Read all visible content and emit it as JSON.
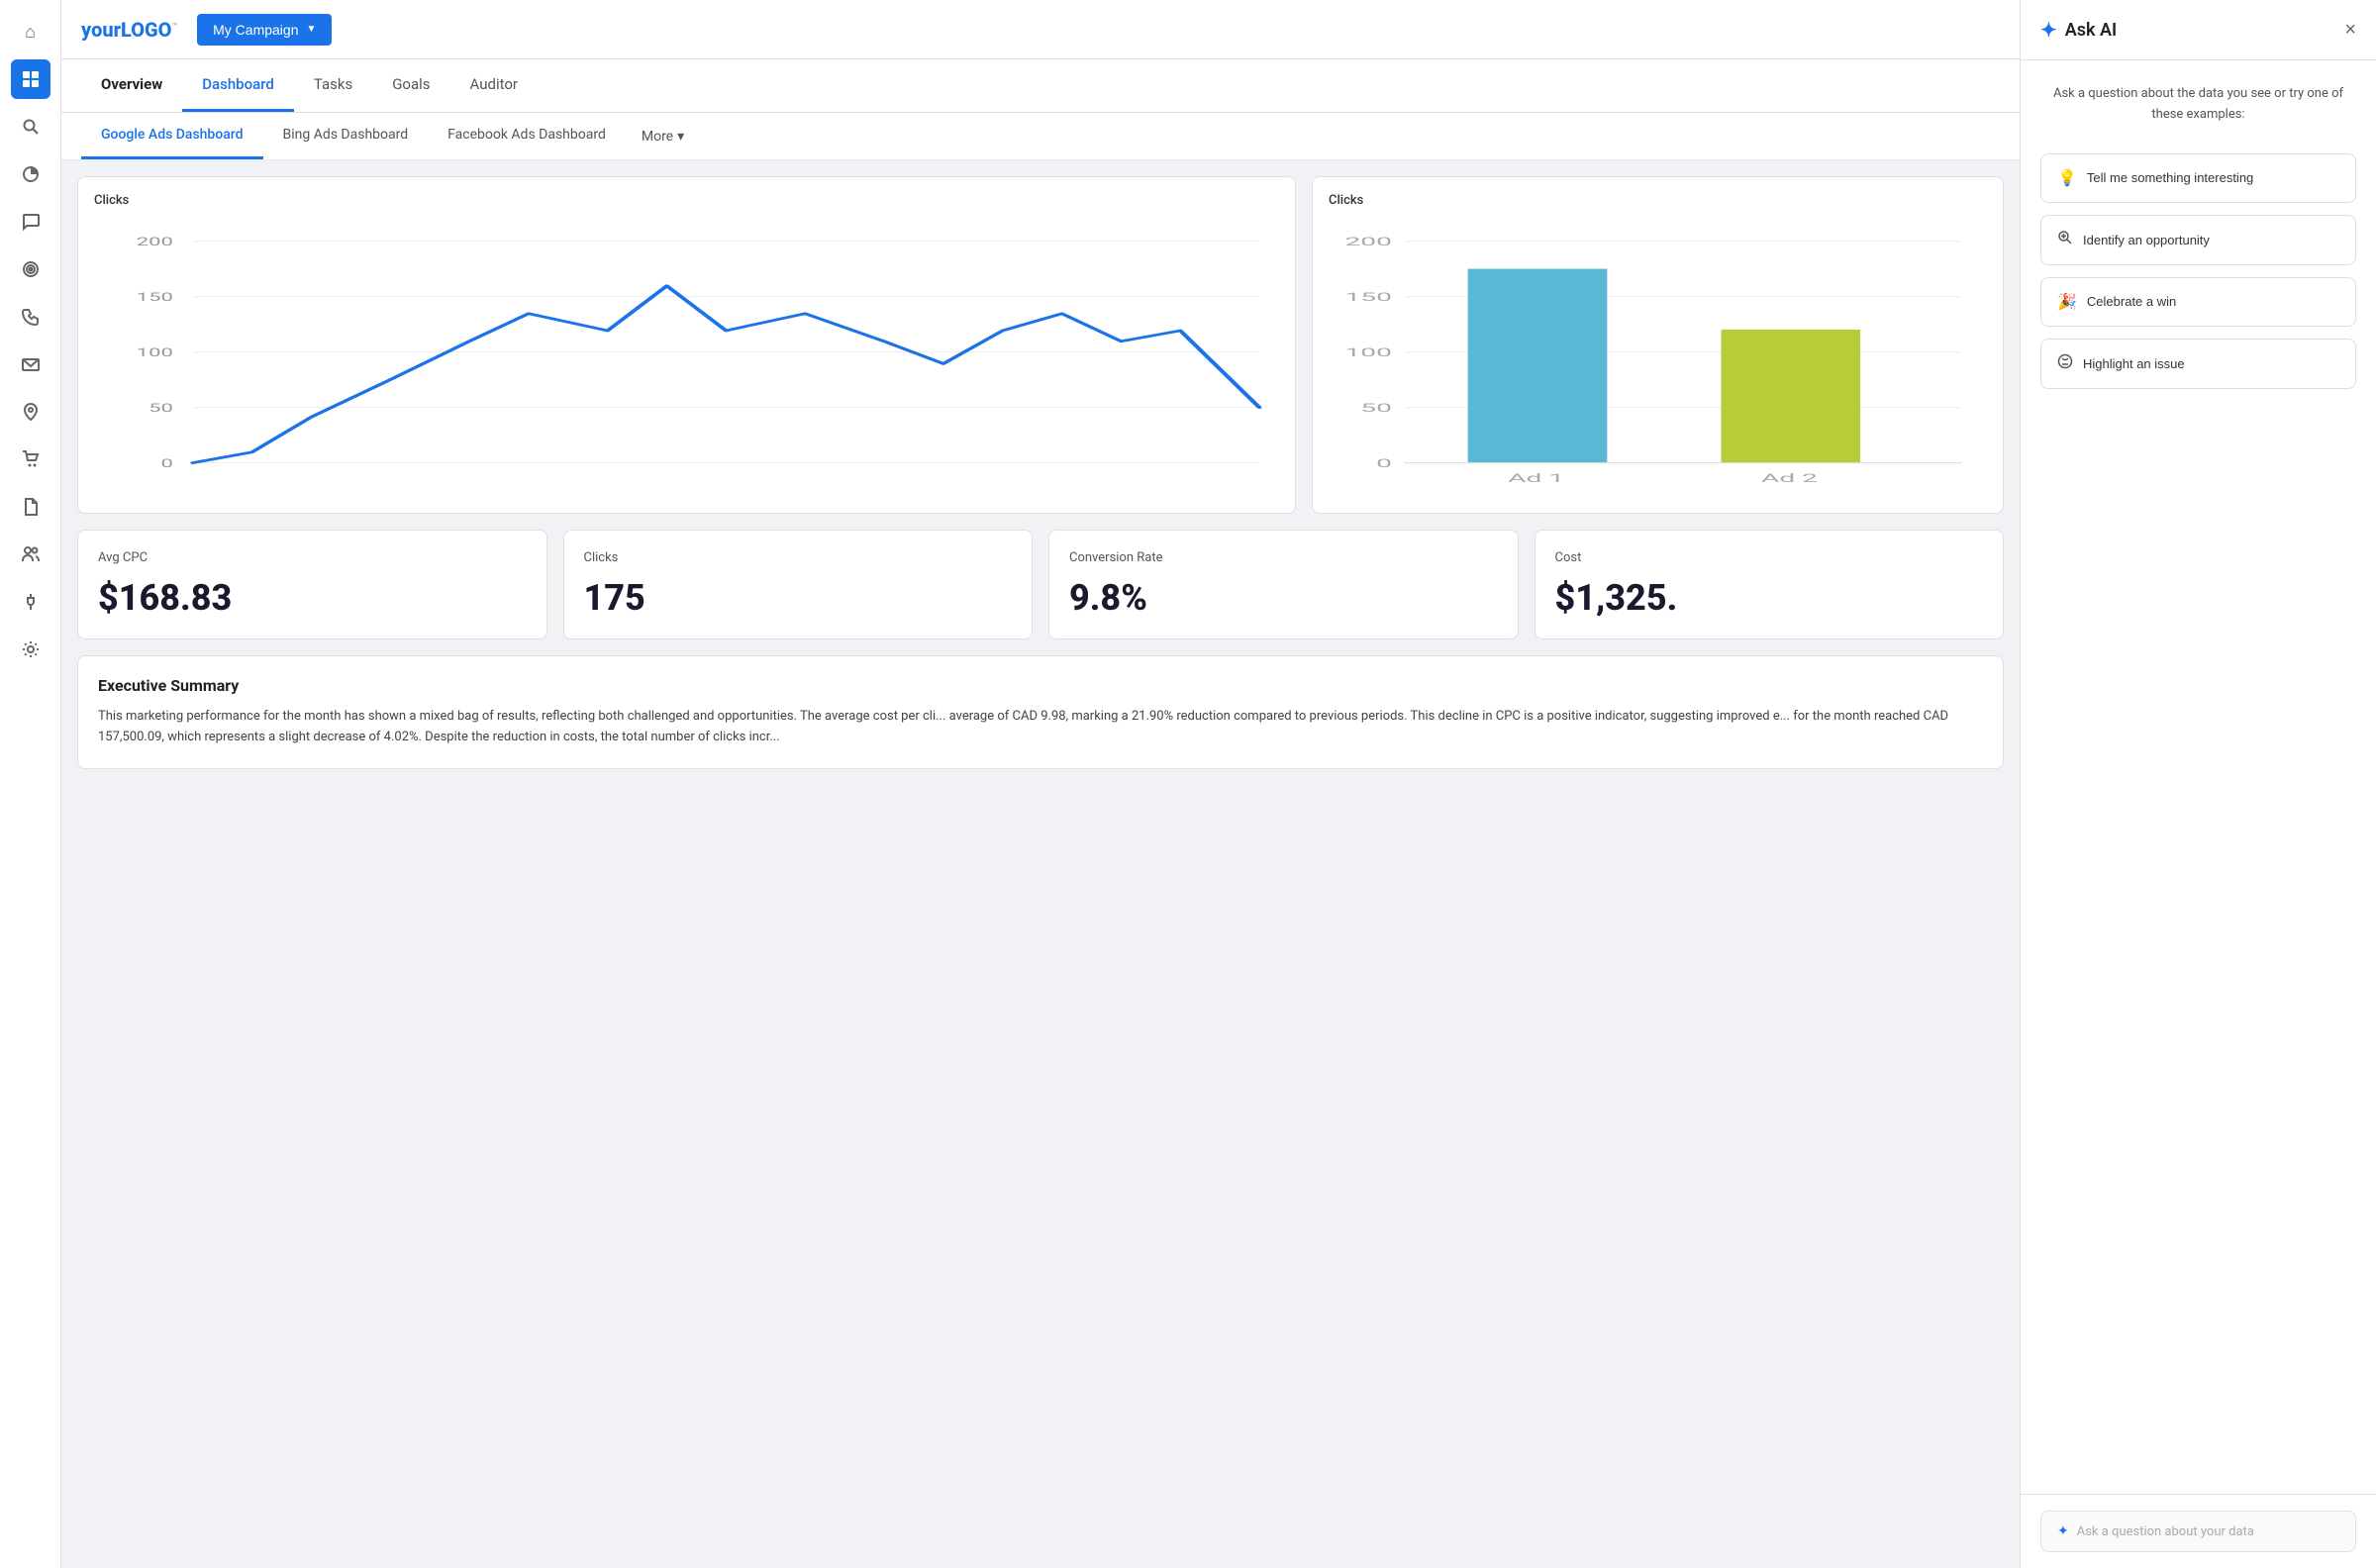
{
  "logo": {
    "text_normal": "your",
    "text_bold": "LOGO",
    "trademark": "™"
  },
  "campaign_button": {
    "label": "My Campaign",
    "chevron": "▼"
  },
  "nav": {
    "tabs": [
      {
        "id": "overview",
        "label": "Overview",
        "active": false
      },
      {
        "id": "dashboard",
        "label": "Dashboard",
        "active": true
      },
      {
        "id": "tasks",
        "label": "Tasks",
        "active": false
      },
      {
        "id": "goals",
        "label": "Goals",
        "active": false
      },
      {
        "id": "auditor",
        "label": "Auditor",
        "active": false
      }
    ]
  },
  "sub_tabs": {
    "tabs": [
      {
        "id": "google",
        "label": "Google Ads Dashboard",
        "active": true
      },
      {
        "id": "bing",
        "label": "Bing Ads Dashboard",
        "active": false
      },
      {
        "id": "facebook",
        "label": "Facebook Ads Dashboard",
        "active": false
      }
    ],
    "more_label": "More"
  },
  "charts": {
    "line_chart": {
      "title": "Clicks",
      "y_labels": [
        "200",
        "150",
        "100",
        "50",
        "0"
      ],
      "color": "#1a73e8"
    },
    "bar_chart": {
      "title": "Clicks",
      "y_labels": [
        "200",
        "150",
        "100",
        "50",
        "0"
      ],
      "bars": [
        {
          "label": "Ad 1",
          "value": 175,
          "color": "#5bb8d4"
        },
        {
          "label": "Ad 2",
          "value": 120,
          "color": "#b8cc3a"
        }
      ]
    }
  },
  "metrics": [
    {
      "label": "Avg CPC",
      "value": "$168.83"
    },
    {
      "label": "Clicks",
      "value": "175"
    },
    {
      "label": "Conversion Rate",
      "value": "9.8%"
    },
    {
      "label": "Cost",
      "value": "$1,325."
    }
  ],
  "executive_summary": {
    "title": "Executive Summary",
    "text": "This marketing performance for the month has shown a mixed bag of results, reflecting both challenged and opportunities. The average cost per cli... average of CAD 9.98, marking a 21.90% reduction compared to previous periods. This decline in CPC is a positive indicator, suggesting improved e... for the month reached CAD 157,500.09, which represents a slight decrease of 4.02%. Despite the reduction in costs, the total number of clicks incr..."
  },
  "ai_panel": {
    "title": "Ask AI",
    "close_label": "×",
    "prompt_text": "Ask a question about the data you see or try one of these examples:",
    "suggestions": [
      {
        "id": "interesting",
        "icon": "💡",
        "label": "Tell me something interesting"
      },
      {
        "id": "opportunity",
        "icon": "🔍",
        "label": "Identify an opportunity"
      },
      {
        "id": "celebrate",
        "icon": "🎉",
        "label": "Celebrate a win"
      },
      {
        "id": "issue",
        "icon": "🔊",
        "label": "Highlight an issue"
      }
    ],
    "input_placeholder": "Ask a question about your data"
  },
  "sidebar_icons": [
    {
      "id": "home",
      "icon": "⌂",
      "active": false
    },
    {
      "id": "grid",
      "icon": "⊞",
      "active": true
    },
    {
      "id": "search",
      "icon": "🔍",
      "active": false
    },
    {
      "id": "chart-pie",
      "icon": "◕",
      "active": false
    },
    {
      "id": "chat",
      "icon": "💬",
      "active": false
    },
    {
      "id": "target",
      "icon": "◎",
      "active": false
    },
    {
      "id": "phone",
      "icon": "📞",
      "active": false
    },
    {
      "id": "mail",
      "icon": "✉",
      "active": false
    },
    {
      "id": "location",
      "icon": "📍",
      "active": false
    },
    {
      "id": "cart",
      "icon": "🛒",
      "active": false
    },
    {
      "id": "doc",
      "icon": "📄",
      "active": false
    },
    {
      "id": "users",
      "icon": "👥",
      "active": false
    },
    {
      "id": "plug",
      "icon": "🔌",
      "active": false
    },
    {
      "id": "settings",
      "icon": "⚙",
      "active": false
    }
  ]
}
